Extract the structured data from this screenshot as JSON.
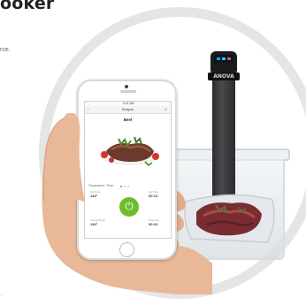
{
  "page": {
    "headline": "ooker",
    "subline": "rce.",
    "margin_mark": "."
  },
  "cooker": {
    "brand": "ANOVA"
  },
  "phone_app": {
    "status_time": "9:41 AM",
    "nav_back_glyph": "‹",
    "nav_title": "Recipes",
    "nav_user_glyph": "☺",
    "screen_title": "Beef",
    "section_label": "Temperature / Timer",
    "stats": [
      {
        "caption": "Set Temp",
        "value": "134°"
      },
      {
        "caption": "Set Time",
        "value": "00:13"
      },
      {
        "caption": "Current Temp",
        "value": "134°"
      },
      {
        "caption": "Time Left",
        "value": "00:13"
      }
    ],
    "power_glyph": "⏻"
  },
  "colors": {
    "accent_green": "#6cbd2e",
    "ring_gray": "#e5e5e5",
    "cooker_black": "#1c1c1e"
  },
  "icons": {
    "cooker_display": "led-display-icon",
    "power": "power-icon",
    "back": "chevron-left-icon",
    "user": "user-icon"
  }
}
